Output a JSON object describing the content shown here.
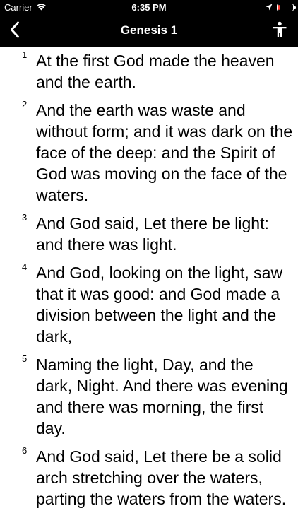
{
  "status_bar": {
    "carrier": "Carrier",
    "time": "6:35 PM",
    "battery_level": 0.12,
    "battery_color": "#ff3b30",
    "icons": [
      "wifi-icon",
      "location-arrow-icon",
      "battery-icon"
    ]
  },
  "navbar": {
    "title": "Genesis 1",
    "back_icon": "chevron-left-icon",
    "accessibility_icon": "accessibility-icon"
  },
  "verses": [
    {
      "num": "1",
      "text": "At the first God made the heaven and the earth."
    },
    {
      "num": "2",
      "text": "And the earth was waste and without form; and it was dark on the face of the deep: and the Spirit of God was moving on the face of the waters."
    },
    {
      "num": "3",
      "text": "And God said, Let there be light: and there was light."
    },
    {
      "num": "4",
      "text": "And God, looking on the light, saw that it was good: and God made a division between the light and the dark,"
    },
    {
      "num": "5",
      "text": "Naming the light, Day, and the dark, Night. And there was evening and there was morning, the first day."
    },
    {
      "num": "6",
      "text": "And God said, Let there be a solid arch stretching over the waters, parting the waters from the waters."
    }
  ]
}
